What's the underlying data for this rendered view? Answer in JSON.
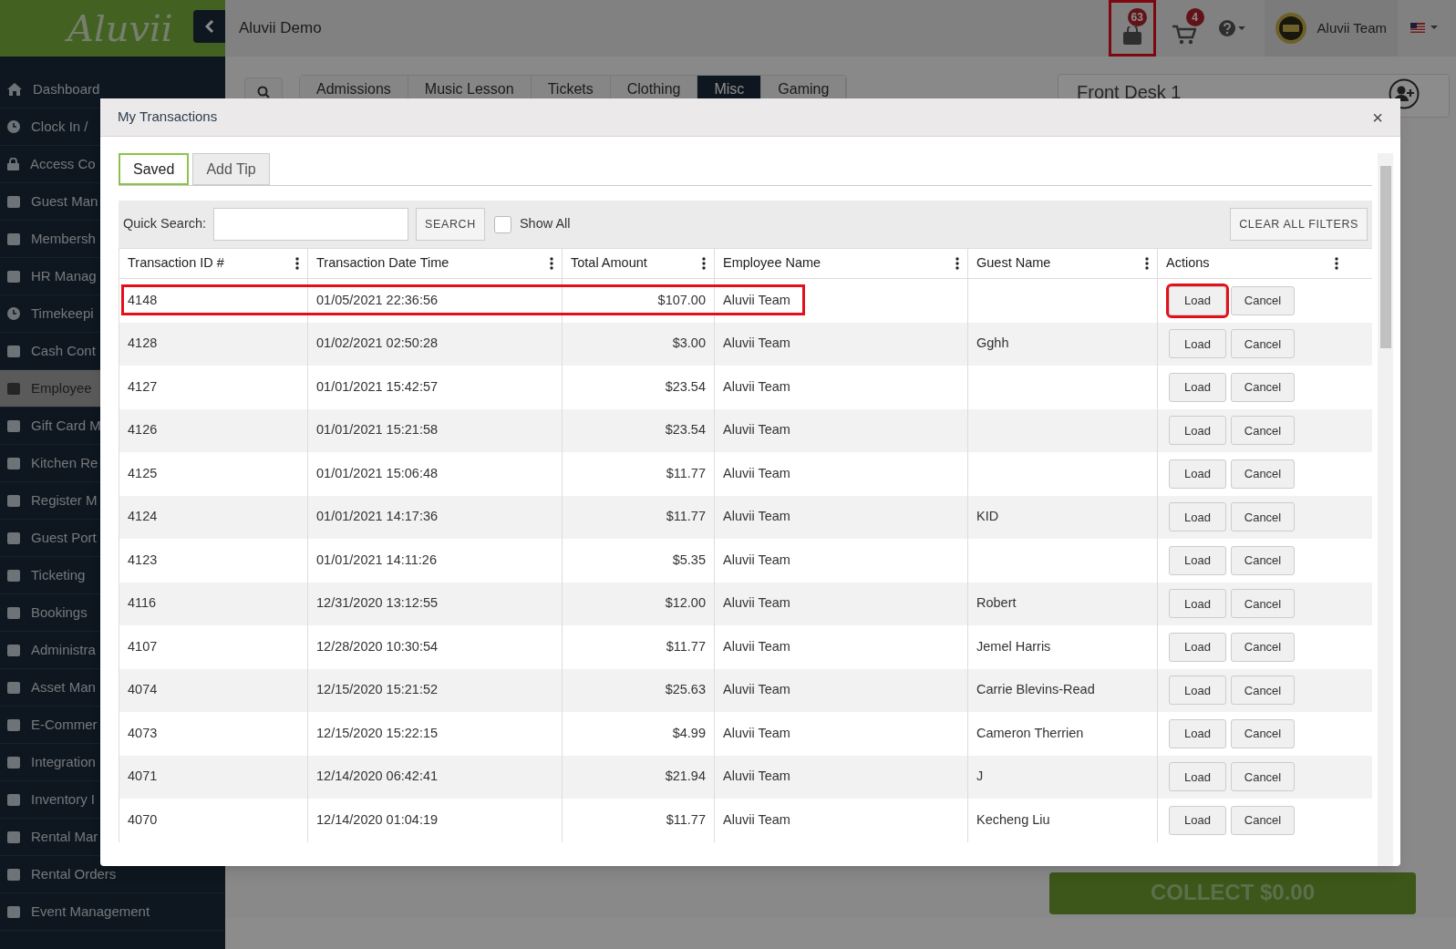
{
  "brand": {
    "logo": "Aluvii"
  },
  "topbar": {
    "title": "Aluvii Demo",
    "bag_badge": "63",
    "bag_highlighted": true,
    "cart_badge": "4",
    "user": "Aluvii Team"
  },
  "sidebar": {
    "items": [
      {
        "label": "Dashboard",
        "selected": false
      },
      {
        "label": "Clock In /",
        "selected": false
      },
      {
        "label": "Access Co",
        "selected": false
      },
      {
        "label": "Guest Man",
        "selected": false
      },
      {
        "label": "Membersh",
        "selected": false
      },
      {
        "label": "HR Manag",
        "selected": false
      },
      {
        "label": "Timekeepi",
        "selected": false
      },
      {
        "label": "Cash Cont",
        "selected": false
      },
      {
        "label": "Employee",
        "selected": true
      },
      {
        "label": "Gift Card M",
        "selected": false
      },
      {
        "label": "Kitchen Re",
        "selected": false
      },
      {
        "label": "Register M",
        "selected": false
      },
      {
        "label": "Guest Port",
        "selected": false
      },
      {
        "label": "Ticketing",
        "selected": false
      },
      {
        "label": "Bookings",
        "selected": false
      },
      {
        "label": "Administra",
        "selected": false
      },
      {
        "label": "Asset Man",
        "selected": false
      },
      {
        "label": "E-Commer",
        "selected": false
      },
      {
        "label": "Integration",
        "selected": false
      },
      {
        "label": "Inventory I",
        "selected": false
      },
      {
        "label": "Rental Mar",
        "selected": false
      },
      {
        "label": "Rental Orders",
        "selected": false
      },
      {
        "label": "Event Management",
        "selected": false
      }
    ]
  },
  "background": {
    "category_tabs": [
      {
        "label": "Admissions",
        "selected": false
      },
      {
        "label": "Music Lesson",
        "selected": false
      },
      {
        "label": "Tickets",
        "selected": false
      },
      {
        "label": "Clothing",
        "selected": false
      },
      {
        "label": "Misc",
        "selected": true
      },
      {
        "label": "Gaming",
        "selected": false
      }
    ],
    "register": "Front Desk 1",
    "collect": "COLLECT $0.00"
  },
  "modal": {
    "title": "My Transactions",
    "close": "×",
    "tabs": [
      {
        "label": "Saved",
        "selected": true
      },
      {
        "label": "Add Tip",
        "selected": false
      }
    ],
    "filters": {
      "label": "Quick Search:",
      "search_button": "SEARCH",
      "show_all": {
        "label": "Show All",
        "checked": false
      },
      "clear_button": "CLEAR ALL FILTERS"
    },
    "table": {
      "columns": [
        "Transaction ID #",
        "Transaction Date Time",
        "Total Amount",
        "Employee Name",
        "Guest Name",
        "Actions"
      ],
      "rows": [
        {
          "id": "4148",
          "date": "01/05/2021 22:36:56",
          "total": "$107.00",
          "employee": "Aluvii Team",
          "guest": "",
          "highlighted": true,
          "load": "Load",
          "load_highlighted": true,
          "cancel": "Cancel"
        },
        {
          "id": "4128",
          "date": "01/02/2021 02:50:28",
          "total": "$3.00",
          "employee": "Aluvii Team",
          "guest": "Gghh",
          "highlighted": false,
          "load": "Load",
          "load_highlighted": false,
          "cancel": "Cancel"
        },
        {
          "id": "4127",
          "date": "01/01/2021 15:42:57",
          "total": "$23.54",
          "employee": "Aluvii Team",
          "guest": "",
          "highlighted": false,
          "load": "Load",
          "load_highlighted": false,
          "cancel": "Cancel"
        },
        {
          "id": "4126",
          "date": "01/01/2021 15:21:58",
          "total": "$23.54",
          "employee": "Aluvii Team",
          "guest": "",
          "highlighted": false,
          "load": "Load",
          "load_highlighted": false,
          "cancel": "Cancel"
        },
        {
          "id": "4125",
          "date": "01/01/2021 15:06:48",
          "total": "$11.77",
          "employee": "Aluvii Team",
          "guest": "",
          "highlighted": false,
          "load": "Load",
          "load_highlighted": false,
          "cancel": "Cancel"
        },
        {
          "id": "4124",
          "date": "01/01/2021 14:17:36",
          "total": "$11.77",
          "employee": "Aluvii Team",
          "guest": "KID",
          "highlighted": false,
          "load": "Load",
          "load_highlighted": false,
          "cancel": "Cancel"
        },
        {
          "id": "4123",
          "date": "01/01/2021 14:11:26",
          "total": "$5.35",
          "employee": "Aluvii Team",
          "guest": "",
          "highlighted": false,
          "load": "Load",
          "load_highlighted": false,
          "cancel": "Cancel"
        },
        {
          "id": "4116",
          "date": "12/31/2020 13:12:55",
          "total": "$12.00",
          "employee": "Aluvii Team",
          "guest": "Robert",
          "highlighted": false,
          "load": "Load",
          "load_highlighted": false,
          "cancel": "Cancel"
        },
        {
          "id": "4107",
          "date": "12/28/2020 10:30:54",
          "total": "$11.77",
          "employee": "Aluvii Team",
          "guest": "Jemel Harris",
          "highlighted": false,
          "load": "Load",
          "load_highlighted": false,
          "cancel": "Cancel"
        },
        {
          "id": "4074",
          "date": "12/15/2020 15:21:52",
          "total": "$25.63",
          "employee": "Aluvii Team",
          "guest": "Carrie Blevins-Read",
          "highlighted": false,
          "load": "Load",
          "load_highlighted": false,
          "cancel": "Cancel"
        },
        {
          "id": "4073",
          "date": "12/15/2020 15:22:15",
          "total": "$4.99",
          "employee": "Aluvii Team",
          "guest": "Cameron Therrien",
          "highlighted": false,
          "load": "Load",
          "load_highlighted": false,
          "cancel": "Cancel"
        },
        {
          "id": "4071",
          "date": "12/14/2020 06:42:41",
          "total": "$21.94",
          "employee": "Aluvii Team",
          "guest": "J",
          "highlighted": false,
          "load": "Load",
          "load_highlighted": false,
          "cancel": "Cancel"
        },
        {
          "id": "4070",
          "date": "12/14/2020 01:04:19",
          "total": "$11.77",
          "employee": "Aluvii Team",
          "guest": "Kecheng Liu",
          "highlighted": false,
          "load": "Load",
          "load_highlighted": false,
          "cancel": "Cancel"
        }
      ]
    }
  }
}
